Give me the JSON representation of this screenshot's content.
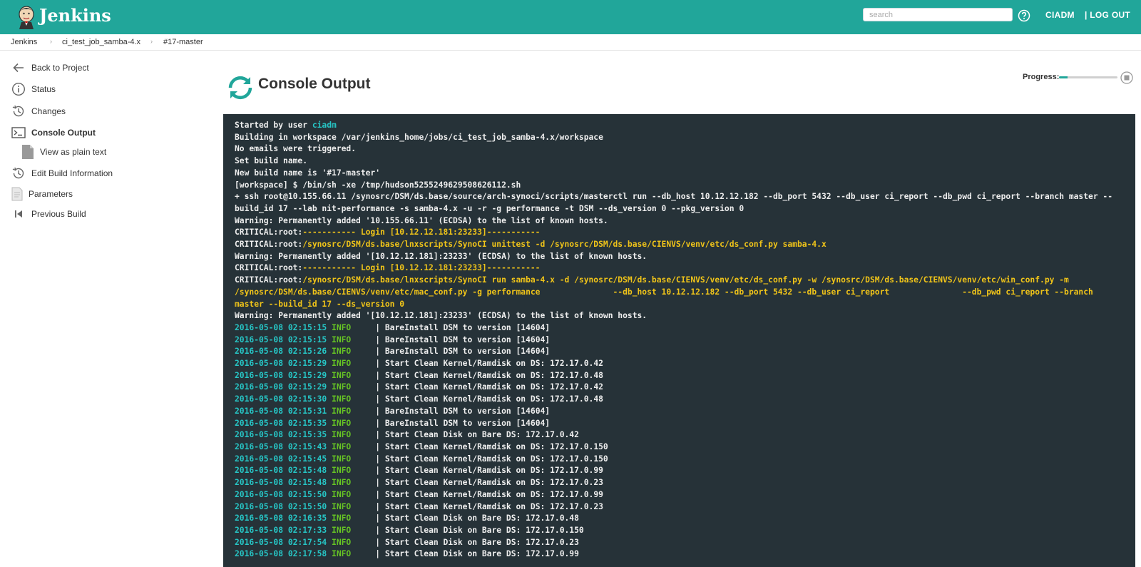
{
  "header": {
    "app_name": "Jenkins",
    "search_placeholder": "search",
    "user": "CIADM",
    "logout": "| LOG OUT"
  },
  "breadcrumb": [
    "Jenkins",
    "ci_test_job_samba-4.x",
    "#17-master"
  ],
  "sidebar": {
    "items": [
      {
        "label": "Back to Project",
        "icon": "arrow-left-icon"
      },
      {
        "label": "Status",
        "icon": "info-icon"
      },
      {
        "label": "Changes",
        "icon": "history-icon"
      },
      {
        "label": "Console Output",
        "icon": "terminal-icon",
        "active": true
      },
      {
        "label": "View as plain text",
        "icon": "document-icon"
      },
      {
        "label": "Edit Build Information",
        "icon": "history-icon"
      },
      {
        "label": "Parameters",
        "icon": "document-icon"
      },
      {
        "label": "Previous Build",
        "icon": "skip-back-icon"
      }
    ]
  },
  "main": {
    "title": "Console Output",
    "progress_label": "Progress:",
    "progress_fraction": 0.15
  },
  "console": {
    "lines": [
      [
        {
          "t": "Started by user "
        },
        {
          "t": "ciadm",
          "c": "cyan"
        }
      ],
      [
        {
          "t": "Building in workspace /var/jenkins_home/jobs/ci_test_job_samba-4.x/workspace"
        }
      ],
      [
        {
          "t": "No emails were triggered."
        }
      ],
      [
        {
          "t": "Set build name."
        }
      ],
      [
        {
          "t": "New build name is '#17-master'"
        }
      ],
      [
        {
          "t": "[workspace] $ /bin/sh -xe /tmp/hudson5255249629508626112.sh"
        }
      ],
      [
        {
          "t": "+ ssh root@10.155.66.11 /synosrc/DSM/ds.base/source/arch-synoci/scripts/masterctl run --db_host 10.12.12.182 --db_port 5432 --db_user ci_report --db_pwd ci_report --branch master --build_id 17 --lab nit-performance -s samba-4.x -u -r -g performance -t DSM --ds_version 0 --pkg_version 0"
        }
      ],
      [
        {
          "t": "Warning: Permanently added '10.155.66.11' (ECDSA) to the list of known hosts."
        }
      ],
      [
        {
          "t": "CRITICAL:root:"
        },
        {
          "t": "----------- Login [10.12.12.181:23233]-----------",
          "c": "yellow"
        }
      ],
      [
        {
          "t": "CRITICAL:root:"
        },
        {
          "t": "/synosrc/DSM/ds.base/lnxscripts/SynoCI unittest -d /synosrc/DSM/ds.base/CIENVS/venv/etc/ds_conf.py samba-4.x",
          "c": "yellow"
        }
      ],
      [
        {
          "t": "Warning: Permanently added '[10.12.12.181]:23233' (ECDSA) to the list of known hosts."
        }
      ],
      [
        {
          "t": "CRITICAL:root:"
        },
        {
          "t": "----------- Login [10.12.12.181:23233]-----------",
          "c": "yellow"
        }
      ],
      [
        {
          "t": "CRITICAL:root:"
        },
        {
          "t": "/synosrc/DSM/ds.base/lnxscripts/SynoCI run samba-4.x -d /synosrc/DSM/ds.base/CIENVS/venv/etc/ds_conf.py -w /synosrc/DSM/ds.base/CIENVS/venv/etc/win_conf.py -m /synosrc/DSM/ds.base/CIENVS/venv/etc/mac_conf.py -g performance               --db_host 10.12.12.182 --db_port 5432 --db_user ci_report               --db_pwd ci_report --branch master --build_id 17 --ds_version 0",
          "c": "yellow"
        }
      ],
      [
        {
          "t": "Warning: Permanently added '[10.12.12.181]:23233' (ECDSA) to the list of known hosts."
        }
      ],
      [
        {
          "t": "2016-05-08 02:15:15 ",
          "c": "cyan"
        },
        {
          "t": "INFO",
          "c": "green"
        },
        {
          "t": "     | BareInstall DSM to version [14604]"
        }
      ],
      [
        {
          "t": "2016-05-08 02:15:15 ",
          "c": "cyan"
        },
        {
          "t": "INFO",
          "c": "green"
        },
        {
          "t": "     | BareInstall DSM to version [14604]"
        }
      ],
      [
        {
          "t": "2016-05-08 02:15:26 ",
          "c": "cyan"
        },
        {
          "t": "INFO",
          "c": "green"
        },
        {
          "t": "     | BareInstall DSM to version [14604]"
        }
      ],
      [
        {
          "t": "2016-05-08 02:15:29 ",
          "c": "cyan"
        },
        {
          "t": "INFO",
          "c": "green"
        },
        {
          "t": "     | Start Clean Kernel/Ramdisk on DS: 172.17.0.42"
        }
      ],
      [
        {
          "t": "2016-05-08 02:15:29 ",
          "c": "cyan"
        },
        {
          "t": "INFO",
          "c": "green"
        },
        {
          "t": "     | Start Clean Kernel/Ramdisk on DS: 172.17.0.48"
        }
      ],
      [
        {
          "t": "2016-05-08 02:15:29 ",
          "c": "cyan"
        },
        {
          "t": "INFO",
          "c": "green"
        },
        {
          "t": "     | Start Clean Kernel/Ramdisk on DS: 172.17.0.42"
        }
      ],
      [
        {
          "t": "2016-05-08 02:15:30 ",
          "c": "cyan"
        },
        {
          "t": "INFO",
          "c": "green"
        },
        {
          "t": "     | Start Clean Kernel/Ramdisk on DS: 172.17.0.48"
        }
      ],
      [
        {
          "t": "2016-05-08 02:15:31 ",
          "c": "cyan"
        },
        {
          "t": "INFO",
          "c": "green"
        },
        {
          "t": "     | BareInstall DSM to version [14604]"
        }
      ],
      [
        {
          "t": "2016-05-08 02:15:35 ",
          "c": "cyan"
        },
        {
          "t": "INFO",
          "c": "green"
        },
        {
          "t": "     | BareInstall DSM to version [14604]"
        }
      ],
      [
        {
          "t": "2016-05-08 02:15:35 ",
          "c": "cyan"
        },
        {
          "t": "INFO",
          "c": "green"
        },
        {
          "t": "     | Start Clean Disk on Bare DS: 172.17.0.42"
        }
      ],
      [
        {
          "t": "2016-05-08 02:15:43 ",
          "c": "cyan"
        },
        {
          "t": "INFO",
          "c": "green"
        },
        {
          "t": "     | Start Clean Kernel/Ramdisk on DS: 172.17.0.150"
        }
      ],
      [
        {
          "t": "2016-05-08 02:15:45 ",
          "c": "cyan"
        },
        {
          "t": "INFO",
          "c": "green"
        },
        {
          "t": "     | Start Clean Kernel/Ramdisk on DS: 172.17.0.150"
        }
      ],
      [
        {
          "t": "2016-05-08 02:15:48 ",
          "c": "cyan"
        },
        {
          "t": "INFO",
          "c": "green"
        },
        {
          "t": "     | Start Clean Kernel/Ramdisk on DS: 172.17.0.99"
        }
      ],
      [
        {
          "t": "2016-05-08 02:15:48 ",
          "c": "cyan"
        },
        {
          "t": "INFO",
          "c": "green"
        },
        {
          "t": "     | Start Clean Kernel/Ramdisk on DS: 172.17.0.23"
        }
      ],
      [
        {
          "t": "2016-05-08 02:15:50 ",
          "c": "cyan"
        },
        {
          "t": "INFO",
          "c": "green"
        },
        {
          "t": "     | Start Clean Kernel/Ramdisk on DS: 172.17.0.99"
        }
      ],
      [
        {
          "t": "2016-05-08 02:15:50 ",
          "c": "cyan"
        },
        {
          "t": "INFO",
          "c": "green"
        },
        {
          "t": "     | Start Clean Kernel/Ramdisk on DS: 172.17.0.23"
        }
      ],
      [
        {
          "t": "2016-05-08 02:16:35 ",
          "c": "cyan"
        },
        {
          "t": "INFO",
          "c": "green"
        },
        {
          "t": "     | Start Clean Disk on Bare DS: 172.17.0.48"
        }
      ],
      [
        {
          "t": "2016-05-08 02:17:33 ",
          "c": "cyan"
        },
        {
          "t": "INFO",
          "c": "green"
        },
        {
          "t": "     | Start Clean Disk on Bare DS: 172.17.0.150"
        }
      ],
      [
        {
          "t": "2016-05-08 02:17:54 ",
          "c": "cyan"
        },
        {
          "t": "INFO",
          "c": "green"
        },
        {
          "t": "     | Start Clean Disk on Bare DS: 172.17.0.23"
        }
      ],
      [
        {
          "t": "2016-05-08 02:17:58 ",
          "c": "cyan"
        },
        {
          "t": "INFO",
          "c": "green"
        },
        {
          "t": "     | Start Clean Disk on Bare DS: 172.17.0.99"
        }
      ]
    ]
  },
  "colors": {
    "header_bg": "#21a69a",
    "console_bg": "#263238",
    "console_text": "#eeeeee",
    "console_cyan": "#26c6c6",
    "console_yellow": "#f0c419",
    "console_green": "#66c424"
  }
}
